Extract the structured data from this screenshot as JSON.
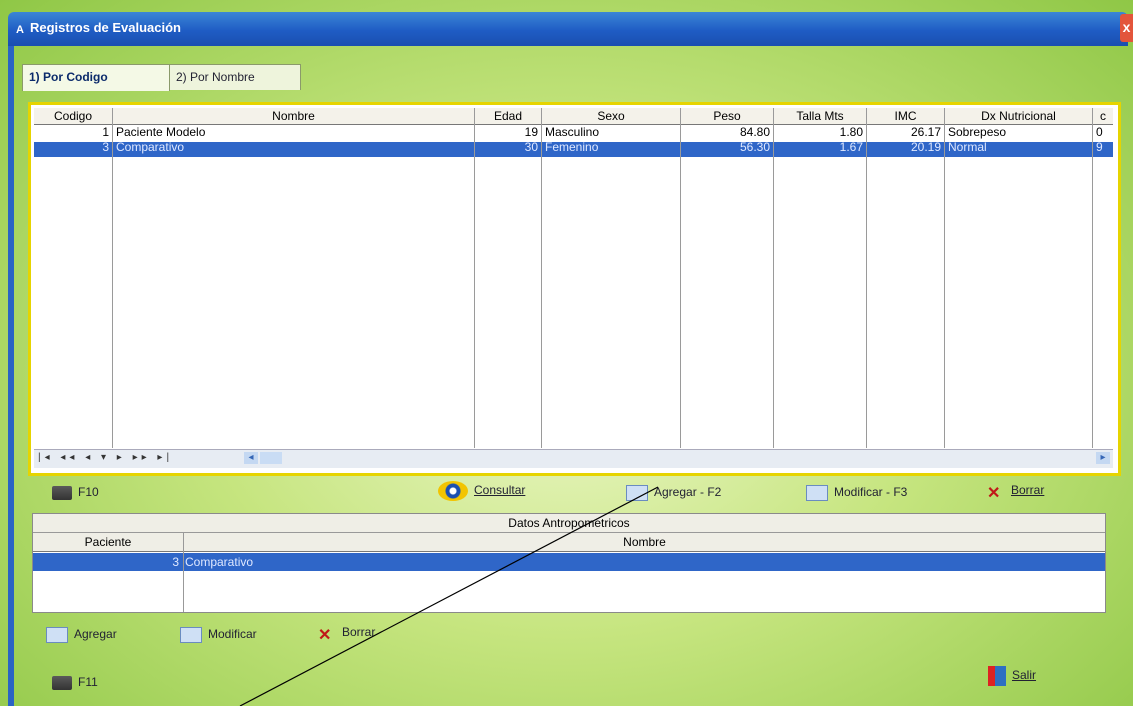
{
  "window": {
    "title": "Registros de Evaluación",
    "close_label": "x",
    "icon_label": "A"
  },
  "tabs": [
    {
      "label": "1) Por Codigo"
    },
    {
      "label": "2) Por Nombre"
    }
  ],
  "grid": {
    "columns": [
      "Codigo",
      "Nombre",
      "Edad",
      "Sexo",
      "Peso",
      "Talla Mts",
      "IMC",
      "Dx Nutricional",
      "c"
    ],
    "rows": [
      [
        "1",
        "Paciente Modelo",
        "19",
        "Masculino",
        "84.80",
        "1.80",
        "26.17",
        "Sobrepeso",
        "0"
      ],
      [
        "3",
        "Comparativo",
        "30",
        "Femenino",
        "56.30",
        "1.67",
        "20.19",
        "Normal",
        "9"
      ]
    ],
    "selected_row": 1,
    "nav_label": "|◂ ◂◂ ◂ ▾ ▸ ▸▸ ▸|"
  },
  "toolbar": {
    "print_label": "F10",
    "consultar_label": "Consultar",
    "agregar_label": "Agregar - F2",
    "modificar_label": "Modificar - F3",
    "borrar_label": "Borrar"
  },
  "antropometricos": {
    "title": "Datos Antropometricos",
    "columns": [
      "Paciente",
      "Nombre"
    ],
    "rows": [
      [
        "3",
        "Comparativo"
      ]
    ]
  },
  "bottom_toolbar": {
    "agregar_label": "Agregar",
    "modificar_label": "Modificar",
    "borrar_label": "Borrar"
  },
  "footer": {
    "print_label": "F11",
    "salir_label": "Salir"
  }
}
